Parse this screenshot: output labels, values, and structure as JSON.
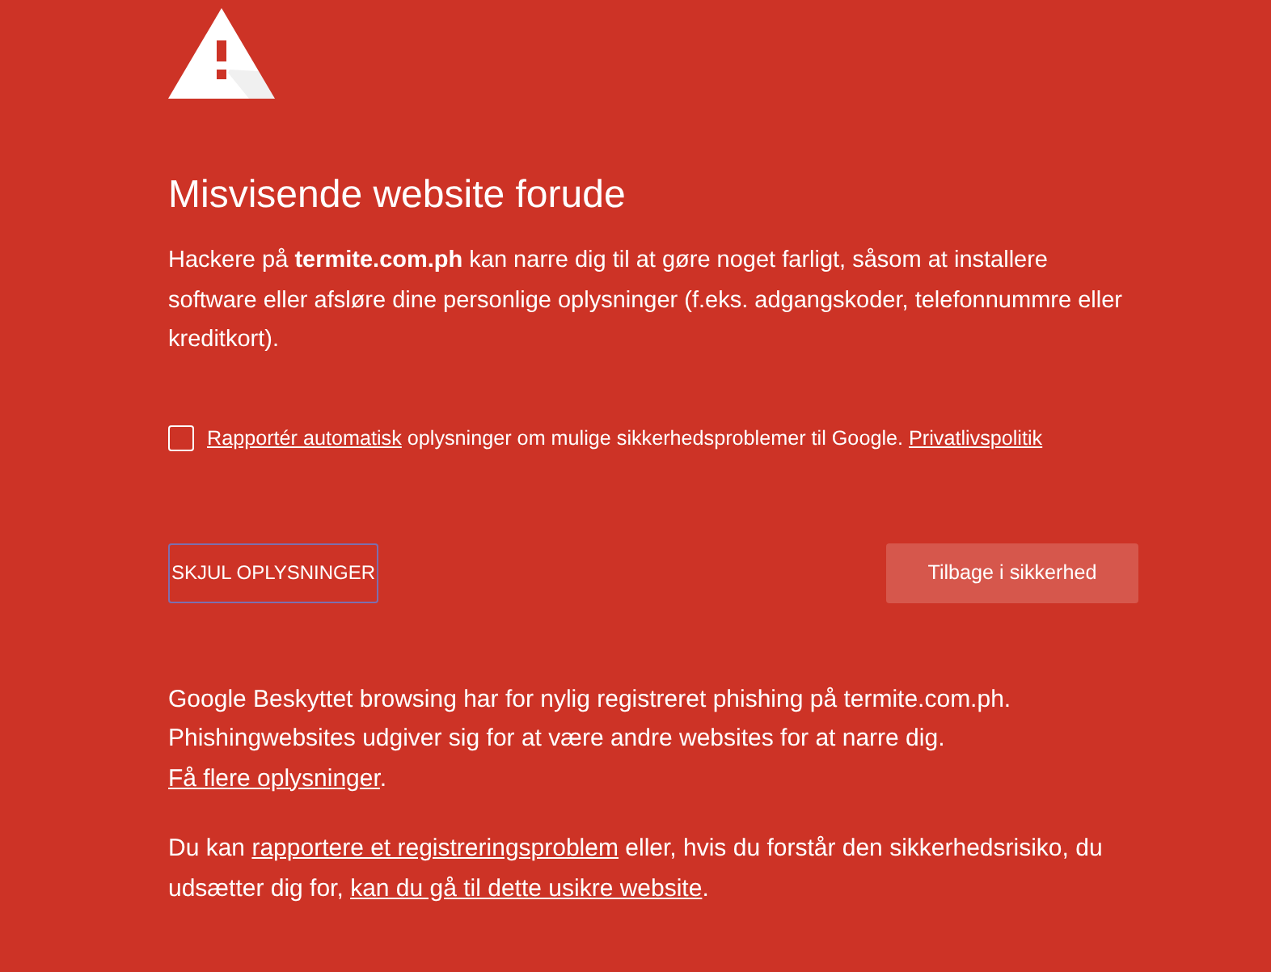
{
  "heading": "Misvisende website forude",
  "intro": "Hackere på **termite.com.ph** kan narre dig til at gøre noget farligt, såsom at installere software eller afsløre dine personlige oplysninger (f.eks. adgangskoder, telefonnummre eller kreditkort).",
  "report_option": {
    "checked": false,
    "segments": [
      {
        "kind": "link",
        "text": "Rapportér automatisk"
      },
      {
        "kind": "text",
        "text": " oplysninger om mulige sikkerhedsproblemer til Google. "
      },
      {
        "kind": "link",
        "text": "Privatlivspolitik"
      }
    ]
  },
  "details_button": {
    "label": "SKJUL OPLYSNINGER",
    "focused": true
  },
  "back_button": {
    "label": "Tilbage i sikkerhed"
  },
  "details": [
    [
      {
        "kind": "text",
        "text": "Google Beskyttet browsing har for nylig registreret phishing på termite.com.ph. Phishingwebsites udgiver sig for at være andre websites for at narre dig. "
      },
      {
        "kind": "link",
        "text": "Få flere oplysninger"
      },
      {
        "kind": "text",
        "text": "."
      }
    ],
    [
      {
        "kind": "text",
        "text": "Du kan "
      },
      {
        "kind": "link",
        "text": "rapportere et registreringsproblem"
      },
      {
        "kind": "text",
        "text": " eller, hvis du forstår den sikkerhedsrisiko, du udsætter dig for, "
      },
      {
        "kind": "link",
        "text": "kan du gå til dette usikre website"
      },
      {
        "kind": "text",
        "text": "."
      }
    ]
  ]
}
